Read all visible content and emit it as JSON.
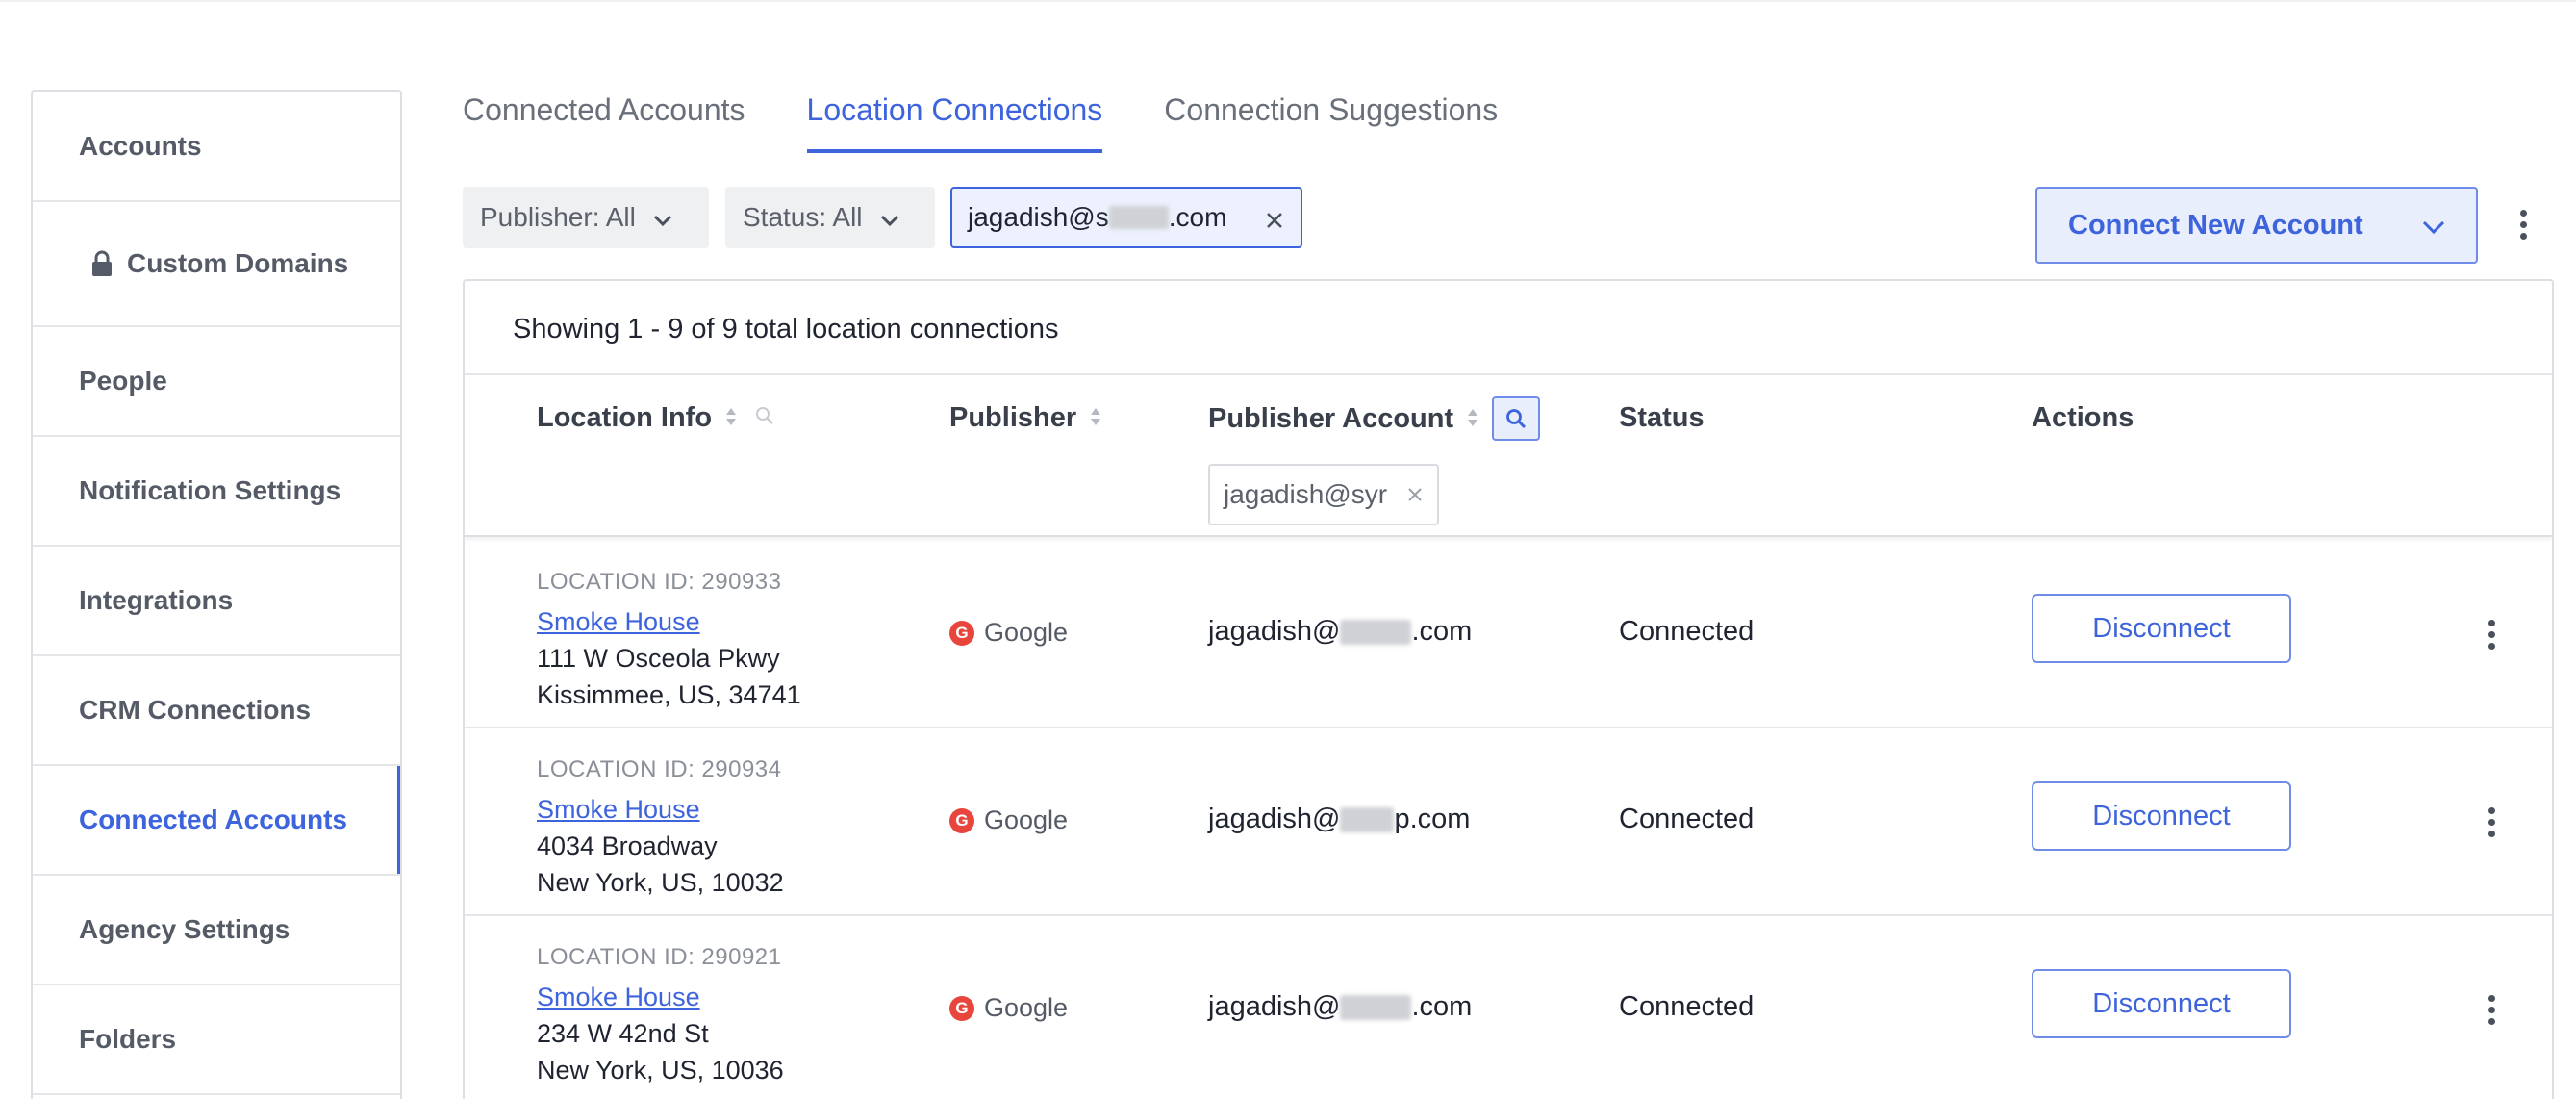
{
  "sidebar": {
    "items": [
      {
        "label": "Accounts"
      },
      {
        "label": "Custom Domains",
        "icon": "lock-icon"
      },
      {
        "label": "People"
      },
      {
        "label": "Notification Settings"
      },
      {
        "label": "Integrations"
      },
      {
        "label": "CRM Connections"
      },
      {
        "label": "Connected Accounts",
        "active": true
      },
      {
        "label": "Agency Settings"
      },
      {
        "label": "Folders"
      }
    ]
  },
  "tabs": [
    {
      "label": "Connected Accounts"
    },
    {
      "label": "Location Connections",
      "active": true
    },
    {
      "label": "Connection Suggestions"
    }
  ],
  "filters": {
    "publisher": "Publisher: All",
    "status": "Status: All",
    "email_prefix": "jagadish@s",
    "email_suffix": ".com"
  },
  "connect_button": "Connect New Account",
  "table": {
    "summary": "Showing 1 - 9 of 9 total location connections",
    "columns": {
      "location_info": "Location Info",
      "publisher": "Publisher",
      "publisher_account": "Publisher Account",
      "status": "Status",
      "actions": "Actions"
    },
    "account_filter_value": "jagadish@syr",
    "rows": [
      {
        "location_id": "LOCATION ID: 290933",
        "name": "Smoke House",
        "address1": "111 W Osceola Pkwy",
        "address2": "Kissimmee, US, 34741",
        "publisher": "Google",
        "account_prefix": "jagadish@",
        "account_suffix": ".com",
        "status": "Connected",
        "action": "Disconnect"
      },
      {
        "location_id": "LOCATION ID: 290934",
        "name": "Smoke House",
        "address1": "4034 Broadway",
        "address2": "New York, US, 10032",
        "publisher": "Google",
        "account_prefix": "jagadish@",
        "account_suffix": "p.com",
        "status": "Connected",
        "action": "Disconnect"
      },
      {
        "location_id": "LOCATION ID: 290921",
        "name": "Smoke House",
        "address1": "234 W 42nd St",
        "address2": "New York, US, 10036",
        "publisher": "Google",
        "account_prefix": "jagadish@",
        "account_suffix": ".com",
        "status": "Connected",
        "action": "Disconnect"
      }
    ]
  },
  "colors": {
    "accent": "#3d63dd",
    "google": "#e8453c"
  }
}
